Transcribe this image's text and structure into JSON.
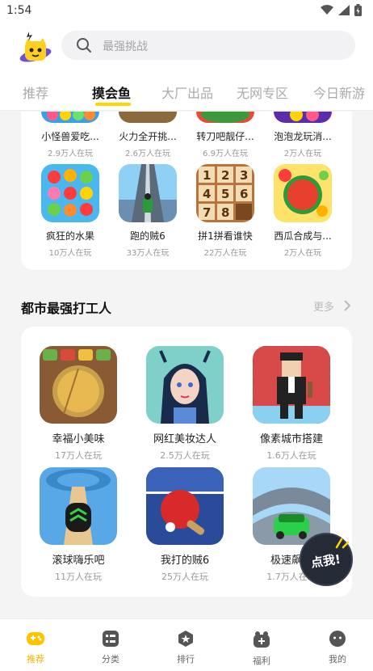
{
  "status_bar": {
    "time": "1:54"
  },
  "search": {
    "placeholder": "最强挑战"
  },
  "tabs": [
    {
      "label": "推荐"
    },
    {
      "label": "摸会鱼",
      "active": true
    },
    {
      "label": "大厂出品"
    },
    {
      "label": "无网专区"
    },
    {
      "label": "今日新游"
    }
  ],
  "top_games": [
    {
      "name": "小怪兽爱吃...",
      "players": "2.9万人在玩"
    },
    {
      "name": "火力全开挑...",
      "players": "2.6万人在玩"
    },
    {
      "name": "转刀吧靓仔...",
      "players": "6.9万人在玩"
    },
    {
      "name": "泡泡龙玩消...",
      "players": "2万人在玩"
    },
    {
      "name": "疯狂的水果",
      "players": "10万人在玩"
    },
    {
      "name": "跑的贼6",
      "players": "33万人在玩"
    },
    {
      "name": "拼1拼看谁快",
      "players": "22万人在玩"
    },
    {
      "name": "西瓜合成与...",
      "players": "2万人在玩"
    }
  ],
  "puzzle_tiles": [
    "1",
    "2",
    "3",
    "4",
    "5",
    "6",
    "7",
    "8"
  ],
  "section": {
    "title": "都市最强打工人",
    "more": "更多"
  },
  "section_games": [
    {
      "name": "幸福小美味",
      "players": "17万人在玩"
    },
    {
      "name": "网红美妆达人",
      "players": "2.5万人在玩"
    },
    {
      "name": "像素城市搭建",
      "players": "1.6万人在玩"
    },
    {
      "name": "滚球嗨乐吧",
      "players": "11万人在玩"
    },
    {
      "name": "我打的贼6",
      "players": "25万人在玩"
    },
    {
      "name": "极速飙车",
      "players": "1.7万人在玩"
    }
  ],
  "float_button": {
    "label": "点我!"
  },
  "bottom_nav": [
    {
      "label": "推荐",
      "icon": "gamepad-icon",
      "active": true
    },
    {
      "label": "分类",
      "icon": "grid-icon"
    },
    {
      "label": "排行",
      "icon": "rank-icon"
    },
    {
      "label": "福利",
      "icon": "gift-icon"
    },
    {
      "label": "我的",
      "icon": "profile-icon"
    }
  ],
  "colors": {
    "accent": "#ffd400",
    "nav_active": "#f5b400",
    "bg": "#f4f4f5"
  }
}
